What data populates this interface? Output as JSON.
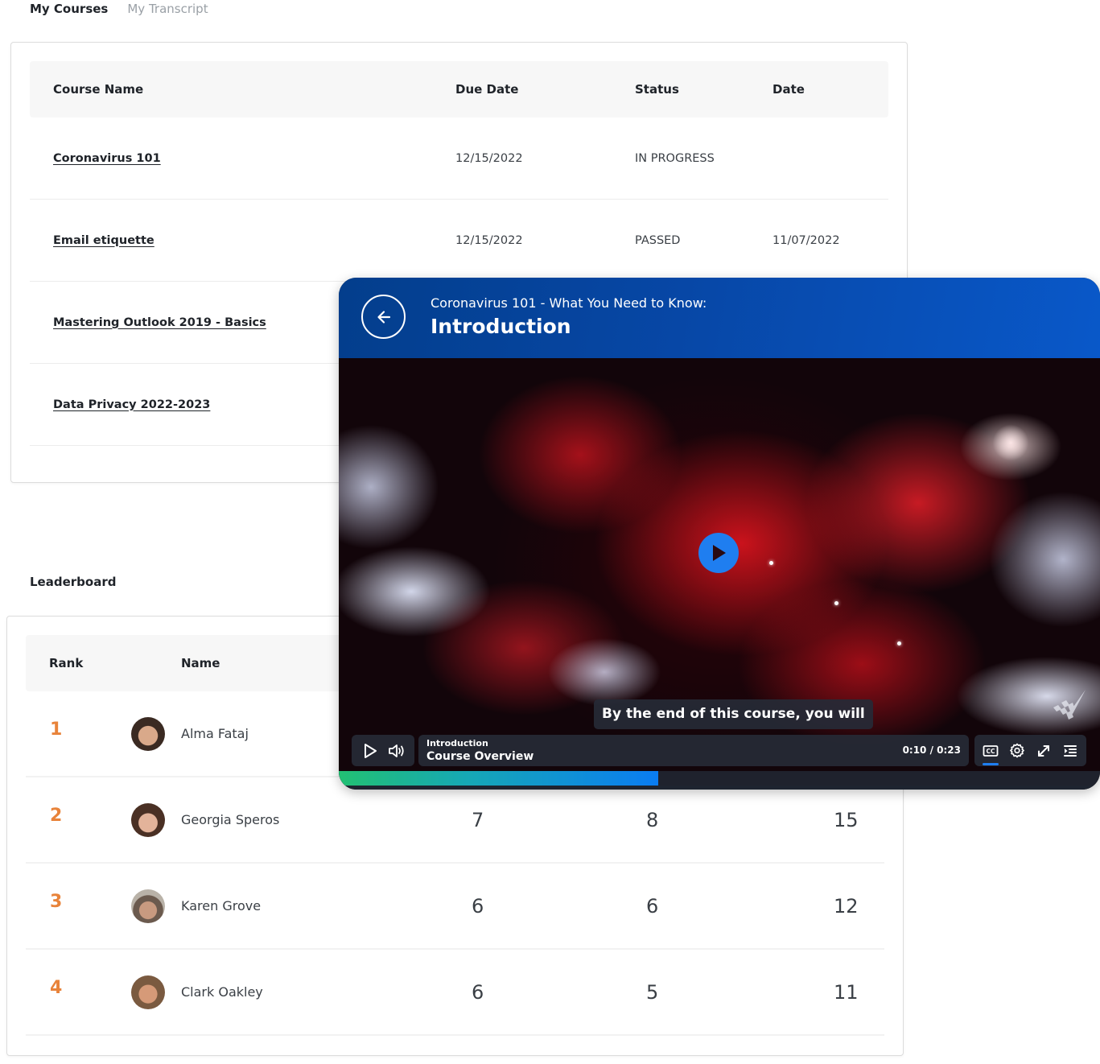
{
  "tabs": [
    {
      "label": "My Courses",
      "active": true
    },
    {
      "label": "My Transcript",
      "active": false
    }
  ],
  "courses": {
    "headers": {
      "name": "Course Name",
      "due": "Due Date",
      "status": "Status",
      "date": "Date"
    },
    "rows": [
      {
        "name": "Coronavirus 101",
        "due": "12/15/2022",
        "status": "IN PROGRESS",
        "date": ""
      },
      {
        "name": "Email etiquette",
        "due": "12/15/2022",
        "status": "PASSED",
        "date": "11/07/2022"
      },
      {
        "name": "Mastering Outlook 2019 - Basics",
        "due": "",
        "status": "",
        "date": ""
      },
      {
        "name": "Data Privacy 2022-2023",
        "due": "",
        "status": "",
        "date": ""
      }
    ]
  },
  "leaderboard": {
    "title": "Leaderboard",
    "headers": {
      "rank": "Rank",
      "name": "Name"
    },
    "rank_color": "#e8833a",
    "rows": [
      {
        "rank": "1",
        "name": "Alma Fataj",
        "col1": "",
        "col2": "",
        "total": "",
        "avatar": "user-avatar"
      },
      {
        "rank": "2",
        "name": "Georgia Speros",
        "col1": "7",
        "col2": "8",
        "total": "15",
        "avatar": "user-avatar"
      },
      {
        "rank": "3",
        "name": "Karen Grove",
        "col1": "6",
        "col2": "6",
        "total": "12",
        "avatar": "user-avatar"
      },
      {
        "rank": "4",
        "name": "Clark Oakley",
        "col1": "6",
        "col2": "5",
        "total": "11",
        "avatar": "user-avatar"
      }
    ]
  },
  "player": {
    "course_title": "Coronavirus 101 - What You Need to Know:",
    "lesson_title": "Introduction",
    "caption": "By the end of this course, you will",
    "current_lesson": "Introduction",
    "current_topic": "Course Overview",
    "time": "0:10 / 0:23",
    "progress_percent": 42,
    "accent_color": "#1f7ef0",
    "icons": {
      "back": "arrow-left-icon",
      "center_play": "play-icon",
      "play": "play-icon",
      "volume": "volume-icon",
      "captions": "closed-captions-icon",
      "settings": "gear-icon",
      "fullscreen": "expand-icon",
      "menu": "playlist-icon"
    }
  }
}
